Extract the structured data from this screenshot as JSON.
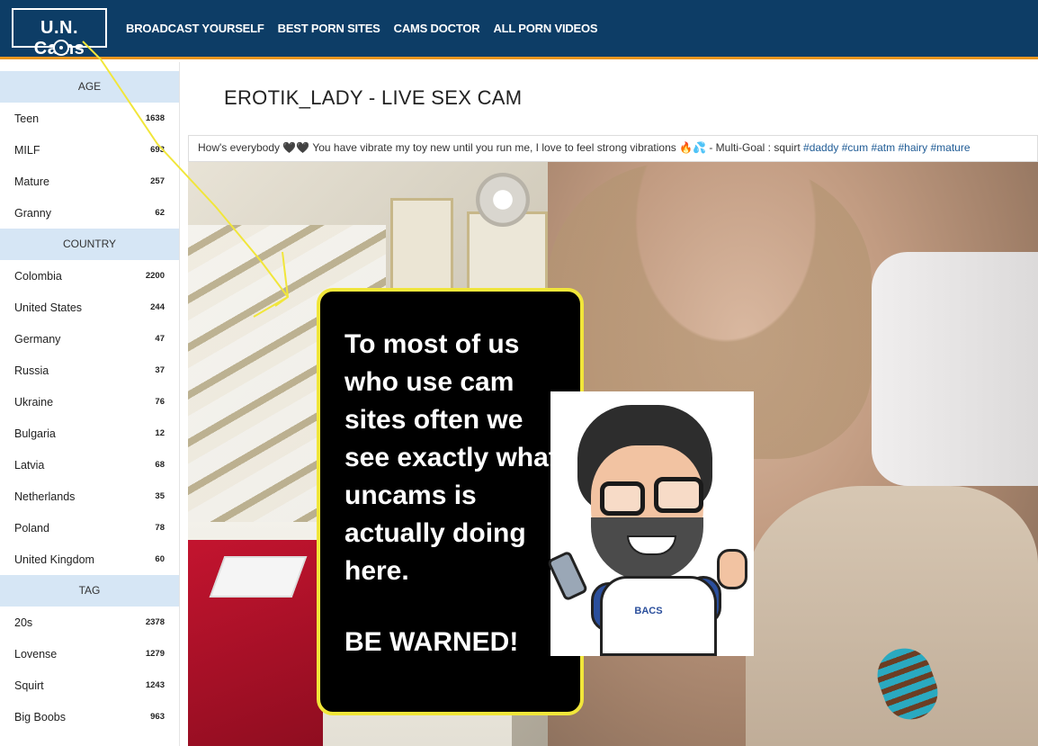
{
  "header": {
    "logo_text": "U.N. Cams",
    "nav": [
      "BROADCAST YOURSELF",
      "BEST PORN SITES",
      "CAMS DOCTOR",
      "ALL PORN VIDEOS"
    ]
  },
  "sidebar": {
    "age": {
      "heading": "AGE",
      "items": [
        {
          "label": "Teen",
          "count": "1638"
        },
        {
          "label": "MILF",
          "count": "693"
        },
        {
          "label": "Mature",
          "count": "257"
        },
        {
          "label": "Granny",
          "count": "62"
        }
      ]
    },
    "country": {
      "heading": "COUNTRY",
      "items": [
        {
          "label": "Colombia",
          "count": "2200"
        },
        {
          "label": "United States",
          "count": "244"
        },
        {
          "label": "Germany",
          "count": "47"
        },
        {
          "label": "Russia",
          "count": "37"
        },
        {
          "label": "Ukraine",
          "count": "76"
        },
        {
          "label": "Bulgaria",
          "count": "12"
        },
        {
          "label": "Latvia",
          "count": "68"
        },
        {
          "label": "Netherlands",
          "count": "35"
        },
        {
          "label": "Poland",
          "count": "78"
        },
        {
          "label": "United Kingdom",
          "count": "60"
        }
      ]
    },
    "tag": {
      "heading": "TAG",
      "items": [
        {
          "label": "20s",
          "count": "2378"
        },
        {
          "label": "Lovense",
          "count": "1279"
        },
        {
          "label": "Squirt",
          "count": "1243"
        },
        {
          "label": "Big Boobs",
          "count": "963"
        }
      ]
    }
  },
  "main": {
    "title": "EROTIK_LADY - LIVE SEX CAM",
    "description_text": "How's everybody 🖤🖤 You have vibrate my toy new until you run me, I love to feel strong vibrations 🔥💦 - Multi-Goal : squirt",
    "description_tags": [
      "#daddy",
      "#cum",
      "#atm",
      "#hairy",
      "#mature"
    ]
  },
  "annotation": {
    "text": "To most of us who use cam sites often we see exactly what uncams is actually doing here.",
    "warning": "BE WARNED!",
    "avatar_badge": "BACS",
    "accent_color": "#f1e63a"
  },
  "colors": {
    "topbar": "#0d3d66",
    "topbar_border": "#e9961f",
    "sidebar_header": "#d6e6f5",
    "tag_link": "#1f5b95"
  }
}
